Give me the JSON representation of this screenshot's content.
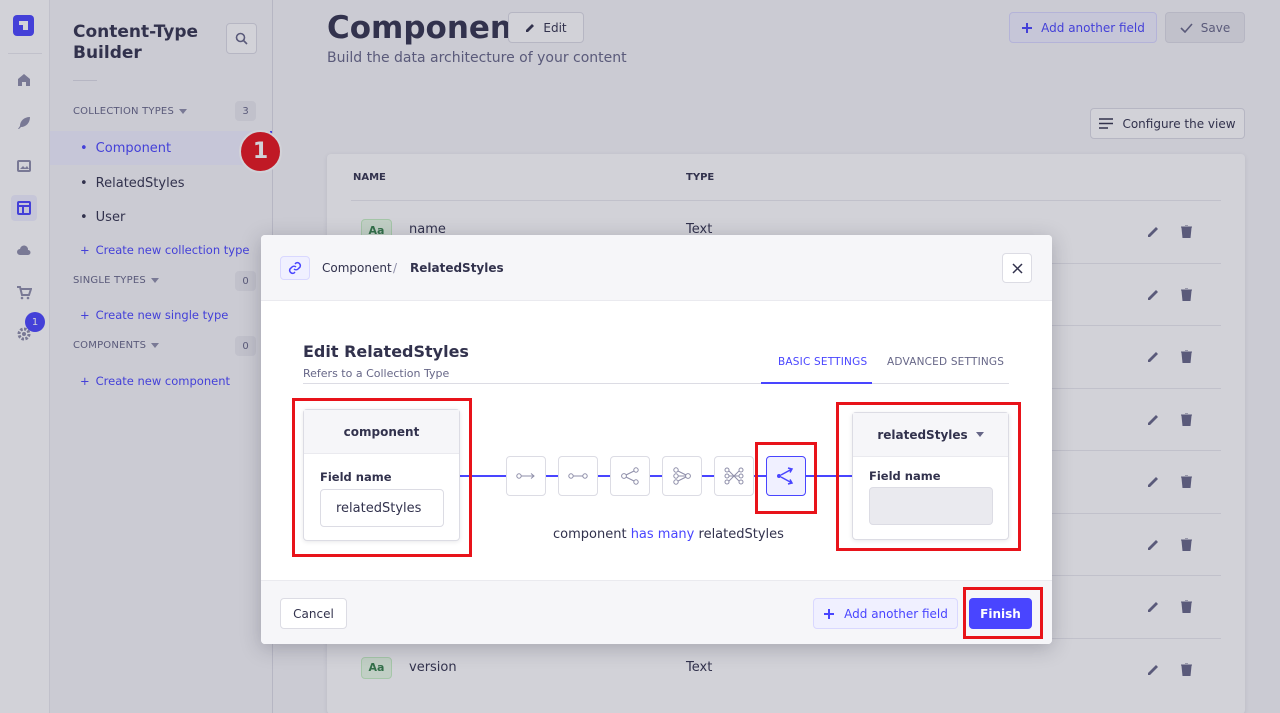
{
  "rail": {
    "badge_count": "1",
    "icons": [
      "strapi-logo-icon",
      "home-icon",
      "feather-icon",
      "media-icon",
      "layout-icon",
      "cloud-icon",
      "cart-icon",
      "gear-icon"
    ]
  },
  "subnav": {
    "title": "Content-Type Builder",
    "collection_types": {
      "label": "COLLECTION TYPES",
      "count": "3",
      "items": [
        {
          "label": "Component"
        },
        {
          "label": "RelatedStyles"
        },
        {
          "label": "User"
        }
      ],
      "create_label": "Create new collection type"
    },
    "single_types": {
      "label": "SINGLE TYPES",
      "count": "0",
      "create_label": "Create new single type"
    },
    "components": {
      "label": "COMPONENTS",
      "count": "0",
      "create_label": "Create new component"
    },
    "step_marker": "1"
  },
  "header": {
    "title": "Component",
    "edit_label": "Edit",
    "subtitle": "Build the data architecture of your content",
    "add_field_label": "Add another field",
    "save_label": "Save",
    "configure_label": "Configure the view"
  },
  "table": {
    "col_name": "NAME",
    "col_type": "TYPE",
    "rows": [
      {
        "icon": "Aa",
        "name": "name",
        "type": "Text"
      },
      {
        "icon": "",
        "name": "",
        "type": ""
      },
      {
        "icon": "",
        "name": "",
        "type": ""
      },
      {
        "icon": "",
        "name": "",
        "type": ""
      },
      {
        "icon": "",
        "name": "",
        "type": ""
      },
      {
        "icon": "",
        "name": "",
        "type": ""
      },
      {
        "icon": "",
        "name": "",
        "type": ""
      },
      {
        "icon": "Aa",
        "name": "version",
        "type": "Text"
      }
    ]
  },
  "modal": {
    "breadcrumb": [
      "Component",
      "/",
      "RelatedStyles"
    ],
    "title": "Edit RelatedStyles",
    "subtitle": "Refers to a Collection Type",
    "tabs": [
      {
        "label": "BASIC SETTINGS",
        "active": true
      },
      {
        "label": "ADVANCED SETTINGS",
        "active": false
      }
    ],
    "left": {
      "header": "component",
      "field_label": "Field name",
      "field_value": "relatedStyles"
    },
    "right": {
      "header": "relatedStyles",
      "field_label": "Field name",
      "field_value": ""
    },
    "relation_icons": [
      "one-way-icon",
      "one-to-one-icon",
      "one-to-many-icon",
      "many-to-one-icon",
      "many-to-many-icon",
      "many-way-icon"
    ],
    "relation_desc": {
      "left": "component",
      "middle": "has many",
      "right": "relatedStyles"
    },
    "cancel_label": "Cancel",
    "add_field_label": "Add another field",
    "finish_label": "Finish"
  },
  "colors": {
    "primary": "#4945ff",
    "annotation": "#e8131a"
  }
}
